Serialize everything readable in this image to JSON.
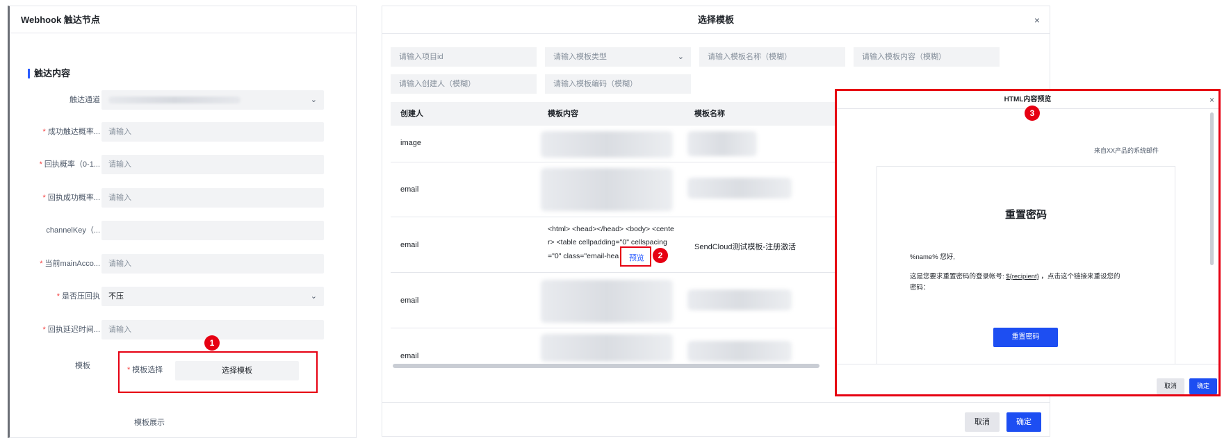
{
  "left_panel": {
    "title": "Webhook 触达节点",
    "section_title": "触达内容",
    "fields": [
      {
        "label": "触达通道",
        "required": false,
        "value": "",
        "placeholder": "",
        "dropdown": true,
        "blurred": true
      },
      {
        "label": "成功触达概率...",
        "required": true,
        "value": "",
        "placeholder": "请输入"
      },
      {
        "label": "回执概率（0-1...",
        "required": true,
        "value": "",
        "placeholder": "请输入"
      },
      {
        "label": "回执成功概率...",
        "required": true,
        "value": "",
        "placeholder": "请输入"
      },
      {
        "label": "channelKey（...",
        "required": false,
        "value": "",
        "placeholder": ""
      },
      {
        "label": "当前mainAcco...",
        "required": true,
        "value": "",
        "placeholder": "请输入"
      },
      {
        "label": "是否压回执",
        "required": true,
        "value": "不压",
        "placeholder": "",
        "dropdown": true
      },
      {
        "label": "回执延迟时间...",
        "required": true,
        "value": "",
        "placeholder": "请输入"
      }
    ],
    "template_label": "模板",
    "template_select_label": "模板选择",
    "template_select_button": "选择模板",
    "template_display_label": "模板展示"
  },
  "modal": {
    "title": "选择模板",
    "close": "×",
    "filters": {
      "project_id": "请输入项目id",
      "template_type": "请输入模板类型",
      "template_name": "请输入模板名称（模糊）",
      "template_content": "请输入模板内容（模糊）",
      "creator": "请输入创建人（模糊）",
      "template_code": "请输入模板编码（模糊）"
    },
    "columns": [
      "创建人",
      "模板内容",
      "模板名称"
    ],
    "rows": [
      {
        "creator": "image",
        "content": "",
        "name": ""
      },
      {
        "creator": "email",
        "content": "",
        "name": ""
      },
      {
        "creator": "email",
        "content_lines": [
          "<html> <head></head> <body> <cente",
          "r> <table cellpadding=\"0\" cellspacing",
          "=\"0\" class=\"email-hea"
        ],
        "preview_link": "预览",
        "name": "SendCloud测试模板-注册激活"
      },
      {
        "creator": "email",
        "content": "",
        "name": ""
      },
      {
        "creator": "email",
        "content": "",
        "name": ""
      }
    ],
    "cancel": "取消",
    "confirm": "确定"
  },
  "preview_dialog": {
    "title": "HTML内容预览",
    "close": "×",
    "sender_note": "来自XX产品的系统邮件",
    "email_heading": "重置密码",
    "greeting": "%name% 您好,",
    "body_before": "这是您要求重置密码的登录帐号: ",
    "recipient_var": "${recipient}",
    "body_after": " ，点击这个链接来重设您的",
    "body_line2": "密码：",
    "action_button": "重置密码",
    "cancel": "取消",
    "confirm": "确定"
  },
  "annotations": {
    "badge_1": "1",
    "badge_2": "2",
    "badge_3": "3",
    "color": "#e60012"
  },
  "colors": {
    "primary": "#1d4ef2",
    "link": "#2b5cff",
    "field_bg": "#f2f3f5",
    "required": "#f53f3f"
  }
}
